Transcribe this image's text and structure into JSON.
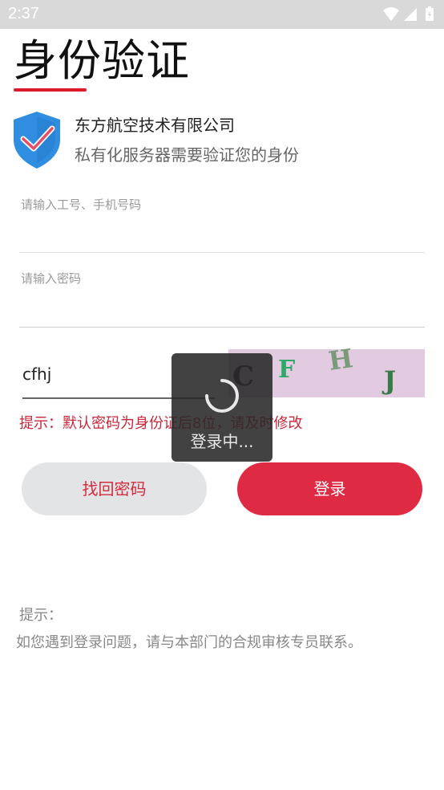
{
  "status_bar": {
    "time": "2:37"
  },
  "header": {
    "title": "身份验证"
  },
  "company": {
    "name": "东方航空技术有限公司",
    "description": "私有化服务器需要验证您的身份"
  },
  "form": {
    "account_placeholder": "请输入工号、手机号码",
    "password_placeholder": "请输入密码",
    "captcha_value": "cfhj",
    "captcha_chars": [
      "C",
      "F",
      "H",
      "J"
    ],
    "warning": "提示：默认密码为身份证后8位，请及时修改"
  },
  "buttons": {
    "forgot": "找回密码",
    "login": "登录"
  },
  "tips": {
    "label": "提示：",
    "text": "如您遇到登录问题，请与本部门的合规审核专员联系。"
  },
  "toast": {
    "message": "登录中..."
  },
  "colors": {
    "accent": "#df2a44",
    "warning": "#c8263a",
    "shield": "#2f8ee0"
  }
}
